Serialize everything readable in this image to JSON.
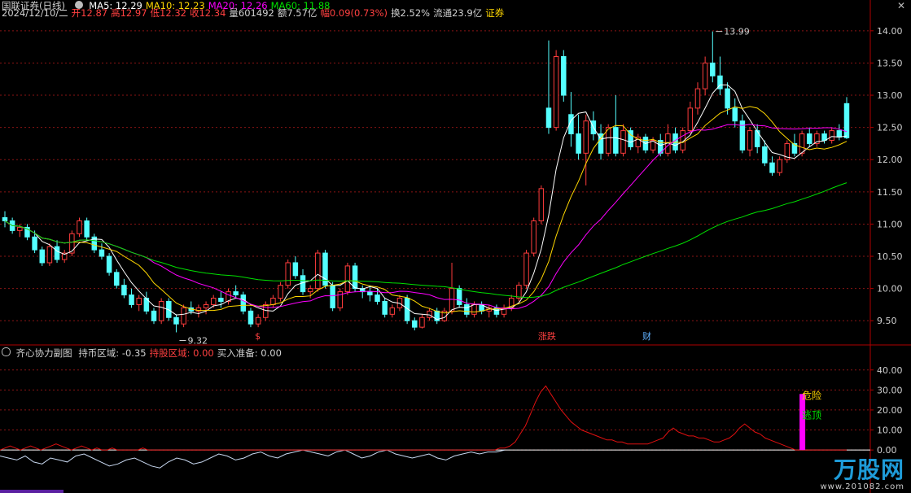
{
  "header": {
    "stock_name": "国联证券(日线)",
    "ma_labels": [
      {
        "text": "MA5: 12.29",
        "color": "#ffffff"
      },
      {
        "text": "MA10: 12.23",
        "color": "#ffd700"
      },
      {
        "text": "MA20: 12.26",
        "color": "#ff00ff"
      },
      {
        "text": "MA60: 11.88",
        "color": "#00e000"
      }
    ],
    "ohlc": [
      {
        "text": "2024/12/10/二",
        "color": "#d0d0d0"
      },
      {
        "text": "开12.87",
        "color": "#ff4040"
      },
      {
        "text": "高12.97",
        "color": "#ff4040"
      },
      {
        "text": "低12.32",
        "color": "#ff4040"
      },
      {
        "text": "收12.34",
        "color": "#ff4040"
      },
      {
        "text": "量601492",
        "color": "#d0d0d0"
      },
      {
        "text": "额7.57亿",
        "color": "#d0d0d0"
      },
      {
        "text": "幅0.09(0.73%)",
        "color": "#ff4040"
      },
      {
        "text": "换2.52%",
        "color": "#d0d0d0"
      },
      {
        "text": "流通23.9亿",
        "color": "#d0d0d0"
      },
      {
        "text": "证券",
        "color": "#ffd700"
      }
    ]
  },
  "sub_header": {
    "title": "齐心协力副图",
    "items": [
      {
        "text": "持币区域: -0.35",
        "color": "#d0d0d0"
      },
      {
        "text": "持股区域: 0.00",
        "color": "#ff4040"
      },
      {
        "text": "买入准备: 0.00",
        "color": "#d0d0d0"
      }
    ]
  },
  "watermark": {
    "name": "万股网",
    "url": "www.201082.com"
  },
  "chart_data": [
    {
      "type": "candlestick",
      "title": "国联证券(日线)",
      "y_ticks": [
        9.5,
        10.0,
        10.5,
        11.0,
        11.5,
        12.0,
        12.5,
        13.0,
        13.5,
        14.0
      ],
      "ylim": [
        9.2,
        14.2
      ],
      "annotations": [
        {
          "text": "9.32",
          "type": "low"
        },
        {
          "text": "13.99",
          "type": "high"
        }
      ],
      "event_markers": [
        {
          "text": "$",
          "color": "#ff4040"
        },
        {
          "text": "涨跌",
          "color": "#ff4040"
        },
        {
          "text": "财",
          "color": "#60b0ff"
        }
      ],
      "candles": [
        [
          11.1,
          11.2,
          10.95,
          11.05
        ],
        [
          11.05,
          11.1,
          10.85,
          10.9
        ],
        [
          10.9,
          11.0,
          10.8,
          10.95
        ],
        [
          10.95,
          11.0,
          10.75,
          10.8
        ],
        [
          10.8,
          10.9,
          10.55,
          10.6
        ],
        [
          10.6,
          10.65,
          10.35,
          10.4
        ],
        [
          10.4,
          10.7,
          10.35,
          10.65
        ],
        [
          10.65,
          10.75,
          10.4,
          10.45
        ],
        [
          10.45,
          10.6,
          10.4,
          10.55
        ],
        [
          10.55,
          10.9,
          10.5,
          10.85
        ],
        [
          10.85,
          11.1,
          10.8,
          11.05
        ],
        [
          11.05,
          11.1,
          10.75,
          10.8
        ],
        [
          10.8,
          10.85,
          10.55,
          10.6
        ],
        [
          10.6,
          10.7,
          10.45,
          10.5
        ],
        [
          10.5,
          10.55,
          10.2,
          10.25
        ],
        [
          10.25,
          10.3,
          10.0,
          10.05
        ],
        [
          10.05,
          10.15,
          9.85,
          9.9
        ],
        [
          9.9,
          10.0,
          9.7,
          9.75
        ],
        [
          9.75,
          9.9,
          9.65,
          9.85
        ],
        [
          9.85,
          9.95,
          9.6,
          9.65
        ],
        [
          9.65,
          9.7,
          9.45,
          9.5
        ],
        [
          9.5,
          9.85,
          9.45,
          9.8
        ],
        [
          9.8,
          9.85,
          9.5,
          9.55
        ],
        [
          9.55,
          9.6,
          9.32,
          9.45
        ],
        [
          9.45,
          9.75,
          9.4,
          9.7
        ],
        [
          9.7,
          9.8,
          9.6,
          9.65
        ],
        [
          9.65,
          9.75,
          9.55,
          9.7
        ],
        [
          9.7,
          9.8,
          9.6,
          9.75
        ],
        [
          9.75,
          9.9,
          9.7,
          9.85
        ],
        [
          9.85,
          9.95,
          9.7,
          9.8
        ],
        [
          9.8,
          10.0,
          9.75,
          9.95
        ],
        [
          9.95,
          10.05,
          9.85,
          9.9
        ],
        [
          9.9,
          9.95,
          9.6,
          9.65
        ],
        [
          9.65,
          9.7,
          9.4,
          9.45
        ],
        [
          9.45,
          9.6,
          9.4,
          9.55
        ],
        [
          9.55,
          9.8,
          9.5,
          9.75
        ],
        [
          9.75,
          9.9,
          9.7,
          9.85
        ],
        [
          9.85,
          10.1,
          9.8,
          10.05
        ],
        [
          10.05,
          10.45,
          10.0,
          10.4
        ],
        [
          10.4,
          10.5,
          10.15,
          10.2
        ],
        [
          10.2,
          10.3,
          9.9,
          9.95
        ],
        [
          9.95,
          10.05,
          9.85,
          10.0
        ],
        [
          10.0,
          10.6,
          9.95,
          10.55
        ],
        [
          10.55,
          10.6,
          10.0,
          10.05
        ],
        [
          10.05,
          10.1,
          9.65,
          9.7
        ],
        [
          9.7,
          10.0,
          9.65,
          9.95
        ],
        [
          9.95,
          10.4,
          9.9,
          10.35
        ],
        [
          10.35,
          10.4,
          9.95,
          10.0
        ],
        [
          10.0,
          10.05,
          9.85,
          9.95
        ],
        [
          9.95,
          10.05,
          9.8,
          9.9
        ],
        [
          9.9,
          10.0,
          9.75,
          9.8
        ],
        [
          9.8,
          9.85,
          9.55,
          9.6
        ],
        [
          9.6,
          9.75,
          9.55,
          9.7
        ],
        [
          9.7,
          9.9,
          9.65,
          9.85
        ],
        [
          9.85,
          9.9,
          9.45,
          9.5
        ],
        [
          9.5,
          9.55,
          9.35,
          9.4
        ],
        [
          9.4,
          9.6,
          9.38,
          9.55
        ],
        [
          9.55,
          9.7,
          9.5,
          9.65
        ],
        [
          9.65,
          9.7,
          9.45,
          9.5
        ],
        [
          9.5,
          9.7,
          9.48,
          9.65
        ],
        [
          9.65,
          10.4,
          9.6,
          10.0
        ],
        [
          10.0,
          10.05,
          9.7,
          9.75
        ],
        [
          9.75,
          9.85,
          9.55,
          9.6
        ],
        [
          9.6,
          9.8,
          9.55,
          9.75
        ],
        [
          9.75,
          9.8,
          9.6,
          9.65
        ],
        [
          9.65,
          9.75,
          9.55,
          9.7
        ],
        [
          9.7,
          9.75,
          9.55,
          9.6
        ],
        [
          9.6,
          9.75,
          9.55,
          9.7
        ],
        [
          9.7,
          9.9,
          9.65,
          9.85
        ],
        [
          9.85,
          10.1,
          9.8,
          10.05
        ],
        [
          10.05,
          10.6,
          10.0,
          10.55
        ],
        [
          10.55,
          11.1,
          10.5,
          11.05
        ],
        [
          11.05,
          11.6,
          11.0,
          11.55
        ],
        [
          12.8,
          13.85,
          12.4,
          12.5
        ],
        [
          12.5,
          13.7,
          12.45,
          13.6
        ],
        [
          13.6,
          13.7,
          12.9,
          13.0
        ],
        [
          12.7,
          13.05,
          12.2,
          12.4
        ],
        [
          12.4,
          12.7,
          12.0,
          12.1
        ],
        [
          12.1,
          12.7,
          11.6,
          12.6
        ],
        [
          12.6,
          12.75,
          12.3,
          12.4
        ],
        [
          12.4,
          12.55,
          12.0,
          12.1
        ],
        [
          12.1,
          12.55,
          12.05,
          12.5
        ],
        [
          12.5,
          13.0,
          12.05,
          12.1
        ],
        [
          12.1,
          12.55,
          12.05,
          12.45
        ],
        [
          12.45,
          12.5,
          12.15,
          12.2
        ],
        [
          12.2,
          12.4,
          12.1,
          12.35
        ],
        [
          12.35,
          12.4,
          12.1,
          12.15
        ],
        [
          12.15,
          12.35,
          12.1,
          12.3
        ],
        [
          12.3,
          12.4,
          12.05,
          12.1
        ],
        [
          12.1,
          12.55,
          12.05,
          12.4
        ],
        [
          12.4,
          12.5,
          12.1,
          12.15
        ],
        [
          12.15,
          12.5,
          12.1,
          12.45
        ],
        [
          12.45,
          12.9,
          12.4,
          12.8
        ],
        [
          12.8,
          13.2,
          12.7,
          13.1
        ],
        [
          13.1,
          13.6,
          13.0,
          13.5
        ],
        [
          13.5,
          13.99,
          13.2,
          13.3
        ],
        [
          13.3,
          13.6,
          13.0,
          13.1
        ],
        [
          13.1,
          13.2,
          12.7,
          12.8
        ],
        [
          12.8,
          12.95,
          12.5,
          12.6
        ],
        [
          12.6,
          12.7,
          12.1,
          12.15
        ],
        [
          12.15,
          12.5,
          12.05,
          12.45
        ],
        [
          12.45,
          12.55,
          12.1,
          12.2
        ],
        [
          12.2,
          12.3,
          11.9,
          11.95
        ],
        [
          11.95,
          12.05,
          11.75,
          11.8
        ],
        [
          11.8,
          12.05,
          11.75,
          12.0
        ],
        [
          12.0,
          12.3,
          11.95,
          12.25
        ],
        [
          12.25,
          12.4,
          12.05,
          12.1
        ],
        [
          12.1,
          12.45,
          12.05,
          12.4
        ],
        [
          12.4,
          12.5,
          12.2,
          12.25
        ],
        [
          12.25,
          12.45,
          12.2,
          12.4
        ],
        [
          12.4,
          12.45,
          12.25,
          12.3
        ],
        [
          12.3,
          12.5,
          12.25,
          12.45
        ],
        [
          12.45,
          12.55,
          12.3,
          12.35
        ],
        [
          12.87,
          12.97,
          12.32,
          12.34
        ]
      ]
    },
    {
      "type": "line",
      "title": "齐心协力副图",
      "y_ticks": [
        0.0,
        10.0,
        20.0,
        30.0,
        40.0
      ],
      "ylim": [
        -15,
        46
      ],
      "annotations": [
        {
          "text": "危险",
          "color": "#ffd700"
        },
        {
          "text": "逃顶",
          "color": "#00e000"
        }
      ],
      "hold_cash": [
        -3,
        -4,
        -5,
        -3,
        -6,
        -7,
        -4,
        -5,
        -6,
        -3,
        -2,
        -4,
        -6,
        -8,
        -7,
        -5,
        -4,
        -6,
        -8,
        -9,
        -6,
        -4,
        -5,
        -7,
        -6,
        -4,
        -2,
        -3,
        -5,
        -4,
        -2,
        -1,
        -3,
        -4,
        -2,
        -1,
        0,
        -1,
        -2,
        -3,
        -1,
        0,
        -2,
        -4,
        -3,
        -1,
        0,
        -2,
        -3,
        -4,
        -3,
        -2,
        -4,
        -5,
        -3,
        -2,
        -1,
        -2,
        -1,
        -1,
        0
      ],
      "hold_stock": [
        0,
        1,
        2,
        1,
        0,
        1,
        2,
        1,
        0,
        1,
        2,
        3,
        2,
        1,
        0,
        1,
        2,
        1,
        0,
        1,
        0,
        0,
        1,
        0,
        0,
        0,
        0,
        0,
        1,
        0,
        0,
        0,
        0,
        0,
        0,
        0,
        0,
        0,
        0,
        0,
        0,
        0,
        0,
        0,
        0,
        0,
        0,
        0,
        0,
        0,
        0,
        0,
        0,
        0,
        0,
        0,
        0,
        0,
        0,
        0,
        0,
        0,
        0,
        0,
        0,
        0,
        0,
        0,
        0,
        0,
        0,
        0,
        0,
        0,
        0,
        0,
        0,
        0,
        0,
        0,
        0,
        0,
        0,
        0,
        0,
        0,
        0,
        0,
        0,
        0,
        0,
        0,
        0,
        0,
        0,
        0,
        0,
        0,
        1,
        1,
        2,
        4,
        8,
        12,
        18,
        24,
        29,
        32,
        28,
        24,
        20,
        17,
        14,
        12,
        10,
        9,
        8,
        7,
        6,
        5,
        5,
        4,
        4,
        3,
        3,
        3,
        3,
        3,
        4,
        5,
        6,
        9,
        11,
        9,
        8,
        7,
        7,
        6,
        6,
        5,
        4,
        4,
        5,
        6,
        8,
        11,
        13,
        11,
        9,
        8,
        6,
        5,
        4,
        3,
        2,
        1,
        0,
        0,
        0,
        0,
        0,
        0,
        0,
        0,
        0,
        0,
        0
      ],
      "signal_bars": [
        {
          "index": 107,
          "value": 28
        }
      ]
    }
  ]
}
